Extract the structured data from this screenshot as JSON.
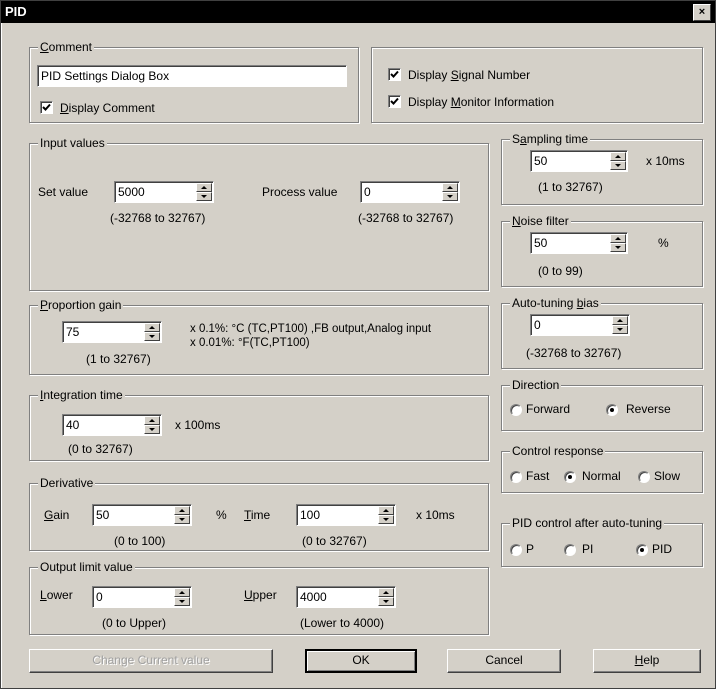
{
  "window": {
    "title": "PID",
    "close": "×"
  },
  "comment": {
    "group_prefix": "",
    "group_u": "C",
    "group_rest": "omment",
    "value": "PID Settings Dialog Box",
    "display_prefix": "",
    "display_u": "D",
    "display_rest": "isplay Comment",
    "display_checked": true
  },
  "display_options": {
    "signal_prefix": "Display ",
    "signal_u": "S",
    "signal_rest": "ignal Number",
    "signal_checked": true,
    "monitor_prefix": "Display ",
    "monitor_u": "M",
    "monitor_rest": "onitor Information",
    "monitor_checked": true
  },
  "input_values": {
    "group": "Input values",
    "set_label": "Set value",
    "set_value": "5000",
    "set_range": "(-32768  to 32767)",
    "proc_label": "Process value",
    "proc_value": "0",
    "proc_range": "(-32768  to 32767)"
  },
  "proportion_gain": {
    "group_prefix": "",
    "group_u": "P",
    "group_rest": "roportion gain",
    "value": "75",
    "range": "(1 to 32767)",
    "note1": "x 0.1%: °C (TC,PT100) ,FB output,Analog input",
    "note2": "x 0.01%: °F(TC,PT100)"
  },
  "integration_time": {
    "group_prefix": "",
    "group_u": "I",
    "group_rest": "ntegration time",
    "value": "40",
    "unit": "x 100ms",
    "range": "(0 to 32767)"
  },
  "derivative": {
    "group": "Derivative",
    "gain_u": "G",
    "gain_rest": "ain",
    "gain_value": "50",
    "gain_unit": "%",
    "gain_range": "(0 to 100)",
    "time_u": "T",
    "time_rest": "ime",
    "time_value": "100",
    "time_unit": "x 10ms",
    "time_range": "(0 to 32767)"
  },
  "output_limit": {
    "group": "Output limit value",
    "lower_u": "L",
    "lower_rest": "ower",
    "lower_value": "0",
    "lower_range": "(0 to Upper)",
    "upper_u": "U",
    "upper_rest": "pper",
    "upper_value": "4000",
    "upper_range": "(Lower to 4000)"
  },
  "sampling_time": {
    "group_prefix": "S",
    "group_u": "a",
    "group_rest": "mpling time",
    "value": "50",
    "unit": "x 10ms",
    "range": "(1 to 32767)"
  },
  "noise_filter": {
    "group_prefix": "",
    "group_u": "N",
    "group_rest": "oise filter",
    "value": "50",
    "unit": "%",
    "range": "(0 to 99)"
  },
  "auto_tuning_bias": {
    "group_prefix": "Auto-tuning ",
    "group_u": "b",
    "group_rest": "ias",
    "value": "0",
    "range": "(-32768 to 32767)"
  },
  "direction": {
    "group": "Direction",
    "forward": "Forward",
    "reverse": "Reverse",
    "selected": "Reverse"
  },
  "control_response": {
    "group": "Control response",
    "fast": "Fast",
    "normal": "Normal",
    "slow": "Slow",
    "selected": "Normal"
  },
  "pid_after": {
    "group": "PID control after auto-tuning",
    "p": "P",
    "pi": "PI",
    "pid": "PID",
    "selected": "PID"
  },
  "buttons": {
    "change_current": "Change Current value",
    "ok": "OK",
    "cancel": "Cancel",
    "help_u": "H",
    "help_rest": "elp"
  },
  "colors": {
    "face": "#d4d0c8",
    "title_bar": "#000000",
    "field": "#ffffff",
    "disabled_text": "#a0a0a0"
  }
}
